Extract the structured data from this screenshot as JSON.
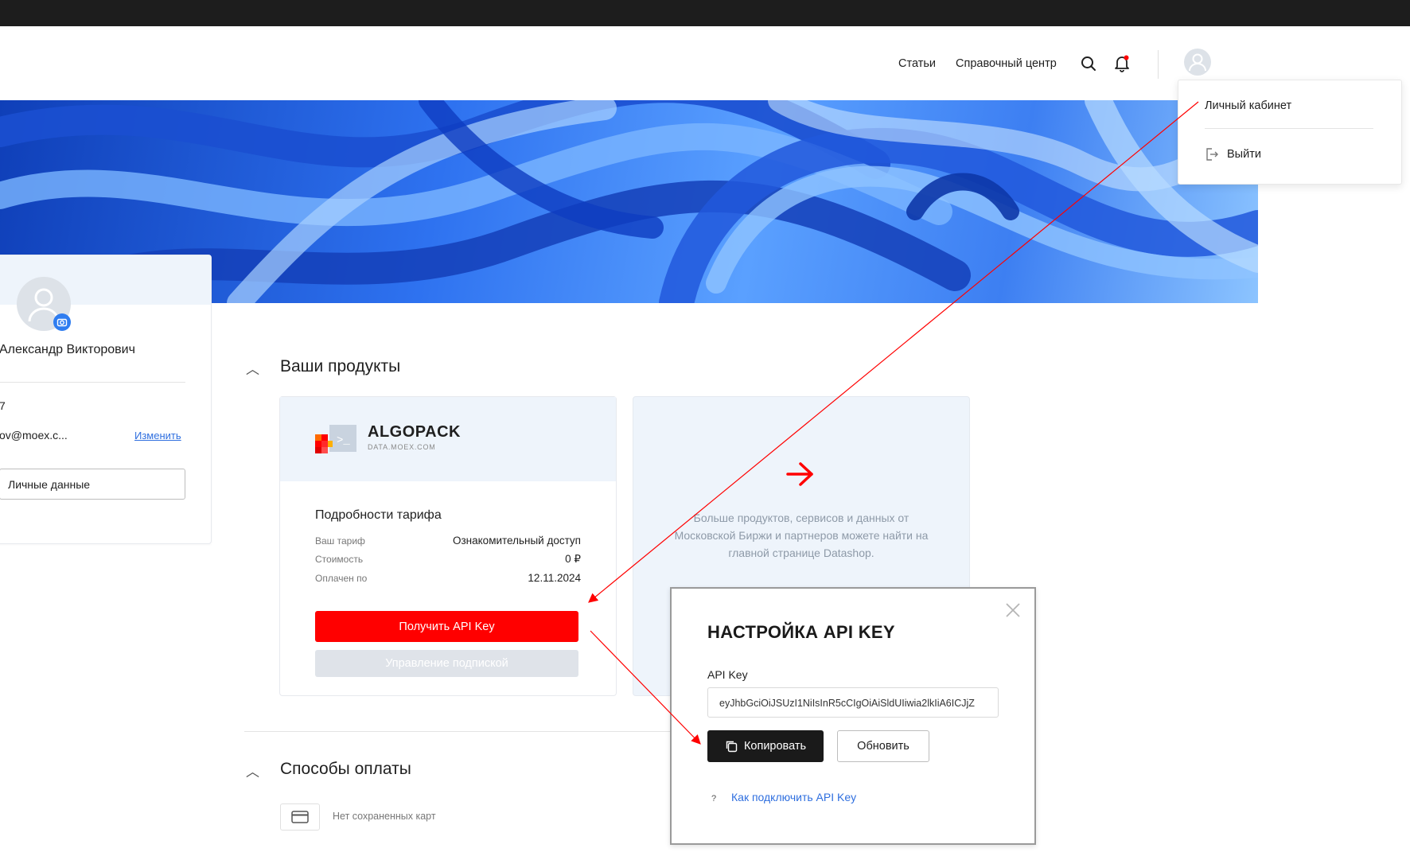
{
  "header": {
    "nav": [
      {
        "label": "Статьи"
      },
      {
        "label": "Справочный центр"
      }
    ],
    "icons": [
      "search-icon",
      "bell-icon",
      "user-avatar-icon"
    ]
  },
  "dropdown": {
    "cabinet": "Личный кабинет",
    "logout": "Выйти"
  },
  "profile": {
    "name": "Александр Викторович",
    "id_fragment": "7",
    "email": "ov@moex.c...",
    "change_link": "Изменить",
    "personal_data_button": "Личные данные"
  },
  "products": {
    "section_title": "Ваши продукты",
    "algopack": {
      "logo_name": "ALGOPACK",
      "logo_sub": "DATA.MOEX.COM",
      "tariff_title": "Подробности тарифа",
      "rows": [
        {
          "label": "Ваш тариф",
          "value": "Ознакомительный доступ"
        },
        {
          "label": "Стоимость",
          "value": "0 ₽"
        },
        {
          "label": "Оплачен по",
          "value": "12.11.2024"
        }
      ],
      "get_api_key": "Получить API Key",
      "manage_subscription": "Управление подпиской"
    },
    "promo": {
      "text": "Больше продуктов, сервисов и данных от Московской Биржи и партнеров можете найти на главной странице Datashop."
    }
  },
  "payment": {
    "section_title": "Способы оплаты",
    "no_cards": "Нет сохраненных карт"
  },
  "modal": {
    "title": "НАСТРОЙКА API KEY",
    "field_label": "API Key",
    "field_value": "eyJhbGciOiJSUzI1NiIsInR5cCIgOiAiSldUIiwia2lkIiA6ICJjZ",
    "copy_button": "Копировать",
    "refresh_button": "Обновить",
    "help_link": "Как подключить API Key",
    "help_mark": "?"
  },
  "colors": {
    "accent_red": "#ff0000",
    "light_blue_bg": "#eef4fb",
    "link_blue": "#2f6fdf",
    "dark": "#1a1a1a"
  }
}
